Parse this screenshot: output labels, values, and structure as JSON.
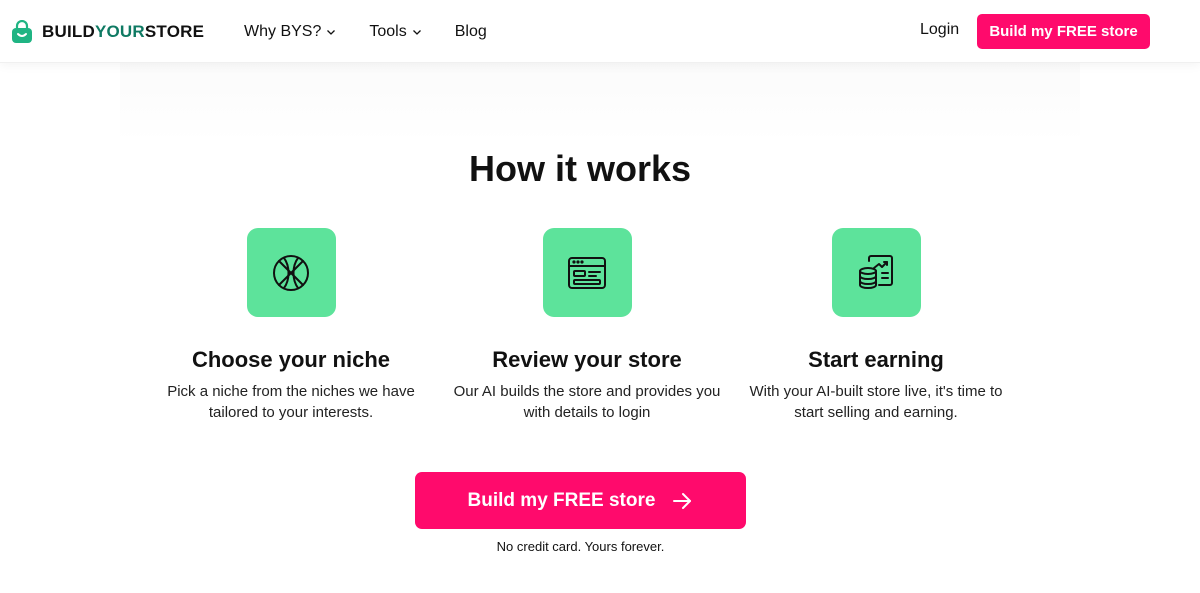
{
  "header": {
    "logo": {
      "part1": "BUILD",
      "part2": "YOUR",
      "part3": "STORE",
      "icon": "shopping-bag-icon"
    },
    "nav": [
      {
        "label": "Why BYS?",
        "has_dropdown": true
      },
      {
        "label": "Tools",
        "has_dropdown": true
      },
      {
        "label": "Blog",
        "has_dropdown": false
      }
    ],
    "login_label": "Login",
    "cta_label": "Build my FREE store"
  },
  "how_it_works": {
    "title": "How it works",
    "steps": [
      {
        "icon": "basketball-icon",
        "title": "Choose your niche",
        "description": "Pick a niche from the niches we have tailored to your interests."
      },
      {
        "icon": "browser-window-icon",
        "title": "Review your store",
        "description": "Our AI builds the store and provides you with details to login"
      },
      {
        "icon": "coins-chart-icon",
        "title": "Start earning",
        "description": "With your AI-built store live, it's time to start selling and earning."
      }
    ]
  },
  "cta": {
    "label": "Build my FREE store",
    "icon": "arrow-right-icon",
    "note": "No credit card. Yours forever."
  },
  "colors": {
    "brand_pink": "#ff0a6c",
    "brand_green": "#5de39b",
    "logo_green": "#0f7a63"
  }
}
